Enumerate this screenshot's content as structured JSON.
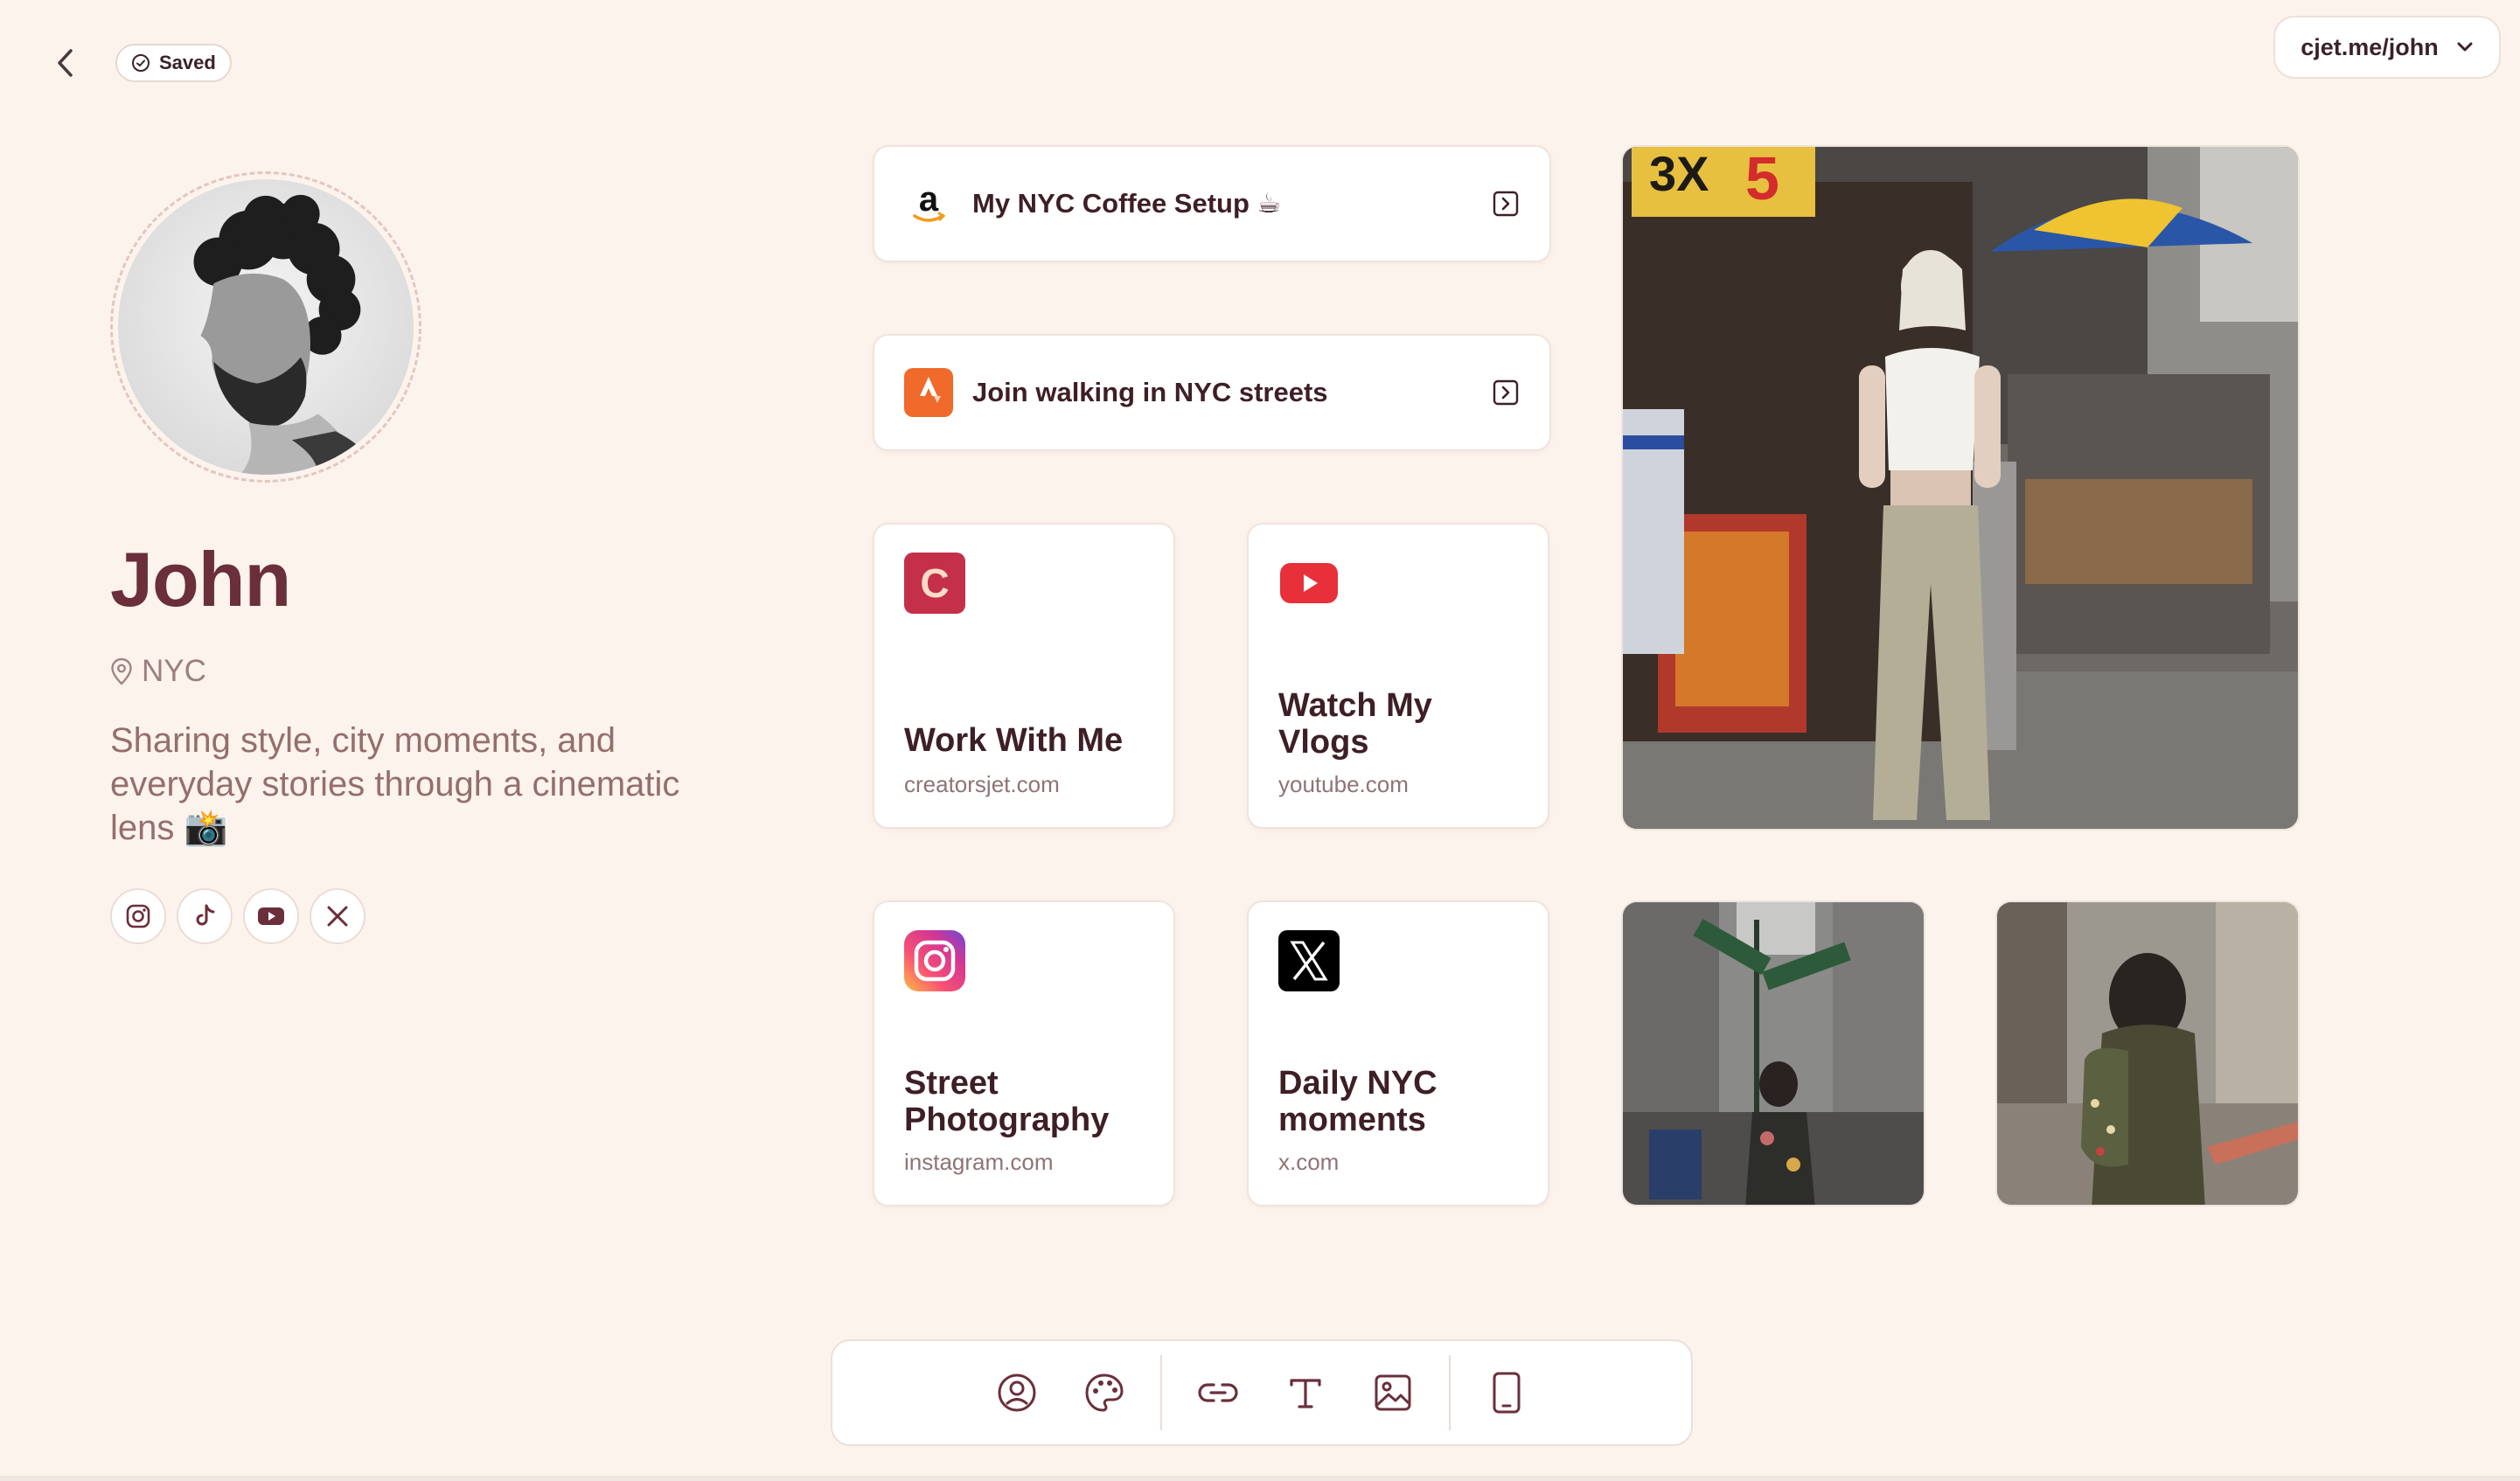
{
  "header": {
    "saved_label": "Saved",
    "profile_url": "cjet.me/john"
  },
  "profile": {
    "name": "John",
    "location": "NYC",
    "bio": "Sharing style, city moments, and everyday stories through a cinematic lens 📸",
    "socials": [
      "instagram-icon",
      "tiktok-icon",
      "youtube-icon",
      "x-icon"
    ]
  },
  "links": {
    "coffee": {
      "title": "My NYC Coffee Setup ☕",
      "icon": "amazon-icon"
    },
    "walking": {
      "title": "Join walking in NYC streets",
      "icon": "strava-icon"
    },
    "work": {
      "title": "Work With Me",
      "domain": "creatorsjet.com"
    },
    "vlogs": {
      "title_line1": "Watch My",
      "title_line2": "Vlogs",
      "domain": "youtube.com"
    },
    "street": {
      "title_line1": "Street",
      "title_line2": "Photography",
      "domain": "instagram.com"
    },
    "daily": {
      "title_line1": "Daily NYC",
      "title_line2": "moments",
      "domain": "x.com"
    }
  },
  "toolbar": {
    "items": [
      "profile-icon",
      "palette-icon",
      "link-icon",
      "text-icon",
      "image-icon",
      "device-icon"
    ]
  },
  "colors": {
    "background": "#fdf3ed",
    "name": "#6a2f3b",
    "text_muted": "#946f6c",
    "youtube_red": "#e8303a",
    "creators_red": "#c4304a",
    "strava_orange": "#f06a2b"
  }
}
